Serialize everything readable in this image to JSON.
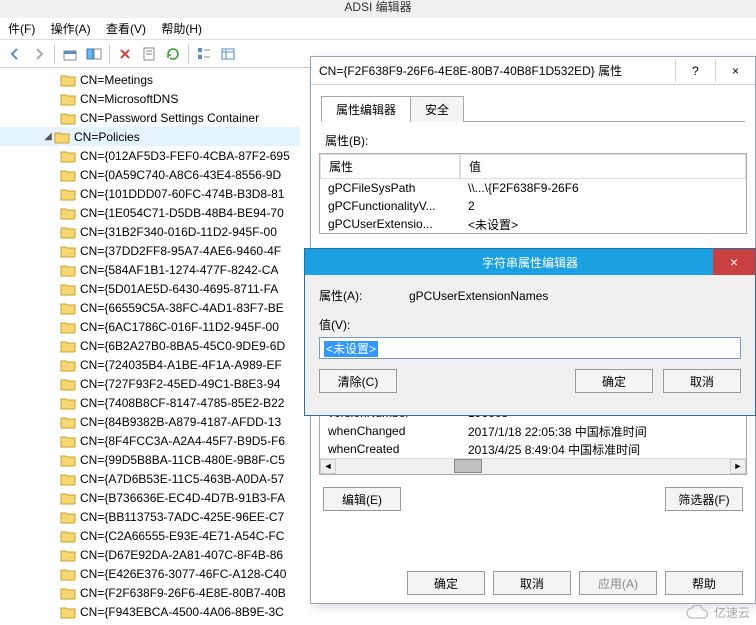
{
  "app_title": "ADSI 编辑器",
  "menu": {
    "file": "件(F)",
    "action": "操作(A)",
    "view": "查看(V)",
    "help": "帮助(H)"
  },
  "tree": {
    "items": [
      {
        "label": "CN=Meetings"
      },
      {
        "label": "CN=MicrosoftDNS"
      },
      {
        "label": "CN=Password Settings Container"
      },
      {
        "label": "CN=Policies",
        "expanded": true,
        "selected": true
      },
      {
        "label": "CN={012AF5D3-FEF0-4CBA-87F2-695"
      },
      {
        "label": "CN={0A59C740-A8C6-43E4-8556-9D"
      },
      {
        "label": "CN={101DDD07-60FC-474B-B3D8-81"
      },
      {
        "label": "CN={1E054C71-D5DB-48B4-BE94-70"
      },
      {
        "label": "CN={31B2F340-016D-11D2-945F-00"
      },
      {
        "label": "CN={37DD2FF8-95A7-4AE6-9460-4F"
      },
      {
        "label": "CN={584AF1B1-1274-477F-8242-CA"
      },
      {
        "label": "CN={5D01AE5D-6430-4695-8711-FA"
      },
      {
        "label": "CN={66559C5A-38FC-4AD1-83F7-BE"
      },
      {
        "label": "CN={6AC1786C-016F-11D2-945F-00"
      },
      {
        "label": "CN={6B2A27B0-8BA5-45C0-9DE9-6D"
      },
      {
        "label": "CN={724035B4-A1BE-4F1A-A989-EF"
      },
      {
        "label": "CN={727F93F2-45ED-49C1-B8E3-94"
      },
      {
        "label": "CN={7408B8CF-8147-4785-85E2-B22"
      },
      {
        "label": "CN={84B9382B-A879-4187-AFDD-13"
      },
      {
        "label": "CN={8F4FCC3A-A2A4-45F7-B9D5-F6"
      },
      {
        "label": "CN={99D5B8BA-11CB-480E-9B8F-C5"
      },
      {
        "label": "CN={A7D6B53E-11C5-463B-A0DA-57"
      },
      {
        "label": "CN={B736636E-EC4D-4D7B-91B3-FA"
      },
      {
        "label": "CN={BB113753-7ADC-425E-96EE-C7"
      },
      {
        "label": "CN={C2A66555-E93E-4E71-A54C-FC"
      },
      {
        "label": "CN={D67E92DA-2A81-407C-8F4B-86"
      },
      {
        "label": "CN={E426E376-3077-46FC-A128-C40"
      },
      {
        "label": "CN={F2F638F9-26F6-4E8E-80B7-40B"
      },
      {
        "label": "CN={F943EBCA-4500-4A06-8B9E-3C"
      }
    ]
  },
  "prop": {
    "title": "CN={F2F638F9-26F6-4E8E-80B7-40B8F1D532ED} 属性",
    "help_btn": "?",
    "close_btn": "×",
    "tabs": {
      "attr": "属性编辑器",
      "sec": "安全"
    },
    "attr_label": "属性(B):",
    "col_name": "属性",
    "col_val": "值",
    "rows_top": [
      {
        "name": "gPCFileSysPath",
        "val": "\\\\...\\{F2F638F9-26F6"
      },
      {
        "name": "gPCFunctionalityV...",
        "val": "2"
      },
      {
        "name": "gPCUserExtensio...",
        "val": "<未设置>"
      }
    ],
    "rows_bottom": [
      {
        "name": "versionNumber",
        "val": "196608"
      },
      {
        "name": "whenChanged",
        "val": "2017/1/18 22:05:38 中国标准时间"
      },
      {
        "name": "whenCreated",
        "val": "2013/4/25 8:49:04 中国标准时间"
      }
    ],
    "edit_btn": "编辑(E)",
    "filter_btn": "筛选器(F)",
    "ok": "确定",
    "cancel": "取消",
    "apply": "应用(A)",
    "help": "帮助"
  },
  "str": {
    "title": "字符串属性编辑器",
    "attr_label": "属性(A):",
    "attr_value": "gPCUserExtensionNames",
    "val_label": "值(V):",
    "input_value": "<未设置>",
    "clear": "清除(C)",
    "ok": "确定",
    "cancel": "取消"
  },
  "watermark": "亿速云"
}
